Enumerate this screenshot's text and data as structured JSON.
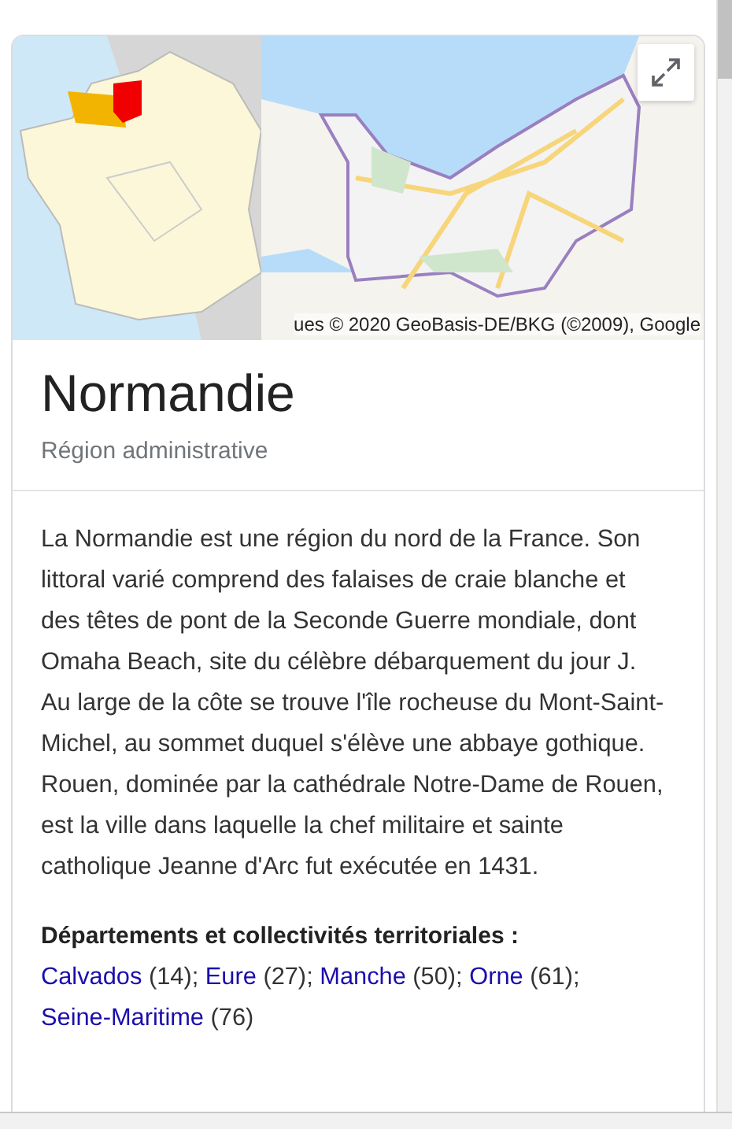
{
  "map": {
    "attribution": "ues © 2020 GeoBasis-DE/BKG (©2009), Google"
  },
  "title": "Normandie",
  "subtitle": "Région administrative",
  "description": "La Normandie est une région du nord de la France. Son littoral varié comprend des falaises de craie blanche et des têtes de pont de la Seconde Guerre mondiale, dont Omaha Beach, site du célèbre débarquement du jour J. Au large de la côte se trouve l'île rocheuse du Mont-Saint-Michel, au sommet duquel s'élève une abbaye gothique. Rouen, dominée par la cathédrale Notre-Dame de Rouen, est la ville dans laquelle la chef militaire et sainte catholique Jeanne d'Arc fut exécutée en 1431.",
  "departments": {
    "heading": "Départements et collectivités territoriales :",
    "items": [
      {
        "name": "Calvados",
        "code": "(14)",
        "separator": ";"
      },
      {
        "name": "Eure",
        "code": "(27)",
        "separator": ";"
      },
      {
        "name": "Manche",
        "code": "(50)",
        "separator": ";"
      },
      {
        "name": "Orne",
        "code": "(61)",
        "separator": ";"
      },
      {
        "name": "Seine-Maritime",
        "code": "(76)"
      }
    ]
  }
}
